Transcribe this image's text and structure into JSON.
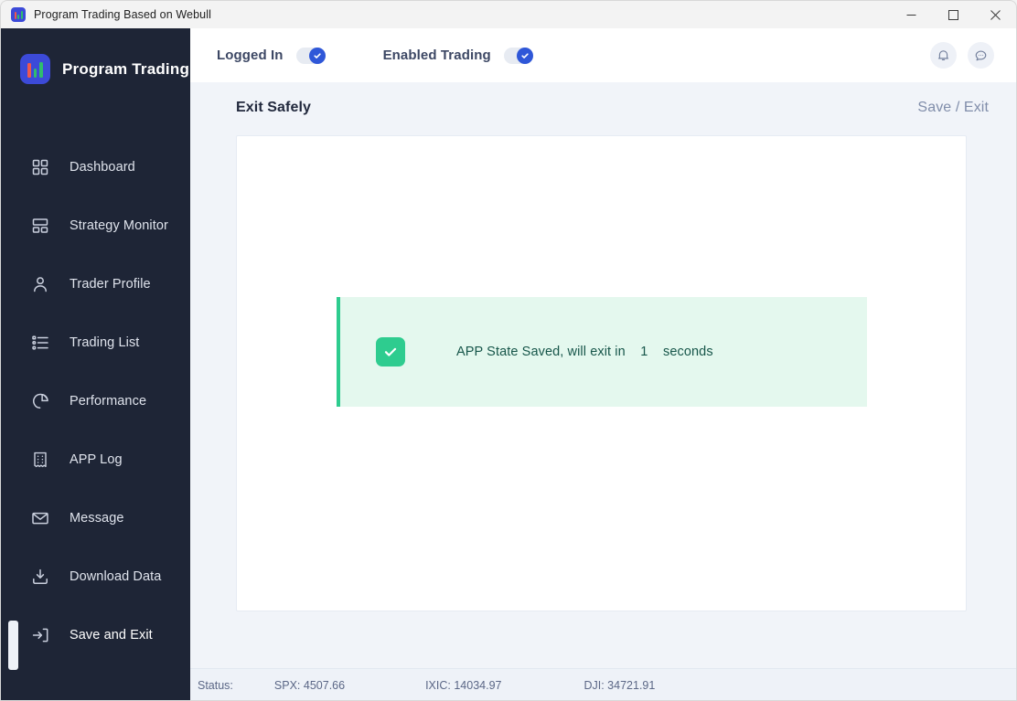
{
  "window": {
    "titlebar_title": "Program Trading Based on Webull",
    "app_icon": "chart-bars-icon",
    "controls": {
      "minimize": "minimize-icon",
      "maximize": "maximize-icon",
      "close": "close-icon"
    }
  },
  "sidebar": {
    "brand": {
      "logo_icon": "chart-bars-icon",
      "name": "Program Trading"
    },
    "items": [
      {
        "label": "Dashboard",
        "icon": "grid-icon",
        "active": false
      },
      {
        "label": "Strategy Monitor",
        "icon": "layout-icon",
        "active": false
      },
      {
        "label": "Trader Profile",
        "icon": "user-icon",
        "active": false
      },
      {
        "label": "Trading List",
        "icon": "list-icon",
        "active": false
      },
      {
        "label": "Performance",
        "icon": "pie-chart-icon",
        "active": false
      },
      {
        "label": "APP Log",
        "icon": "receipt-icon",
        "active": false
      },
      {
        "label": "Message",
        "icon": "envelope-icon",
        "active": false
      },
      {
        "label": "Download Data",
        "icon": "download-icon",
        "active": false
      },
      {
        "label": "Save and Exit",
        "icon": "logout-icon",
        "active": true
      }
    ]
  },
  "topbar": {
    "toggles": [
      {
        "label": "Logged In",
        "state": "on"
      },
      {
        "label": "Enabled Trading",
        "state": "on"
      }
    ],
    "actions": [
      {
        "icon": "bell-icon"
      },
      {
        "icon": "chat-bubble-icon"
      }
    ]
  },
  "content": {
    "page_title": "Exit Safely",
    "save_exit_link": "Save / Exit",
    "alert": {
      "icon": "check-square-icon",
      "message": "APP State Saved, will exit in    1    seconds",
      "seconds": "1",
      "type": "success"
    }
  },
  "statusbar": {
    "prefix": "Status:",
    "indices": [
      {
        "label": "SPX: 4507.66"
      },
      {
        "label": "IXIC: 14034.97"
      },
      {
        "label": "DJI: 34721.91"
      }
    ]
  },
  "colors": {
    "sidebar_bg": "#1e2536",
    "accent_blue": "#2f57d8",
    "success_green": "#2ecc8f",
    "alert_bg": "#e4f8ee",
    "content_bg": "#f1f4f9"
  }
}
